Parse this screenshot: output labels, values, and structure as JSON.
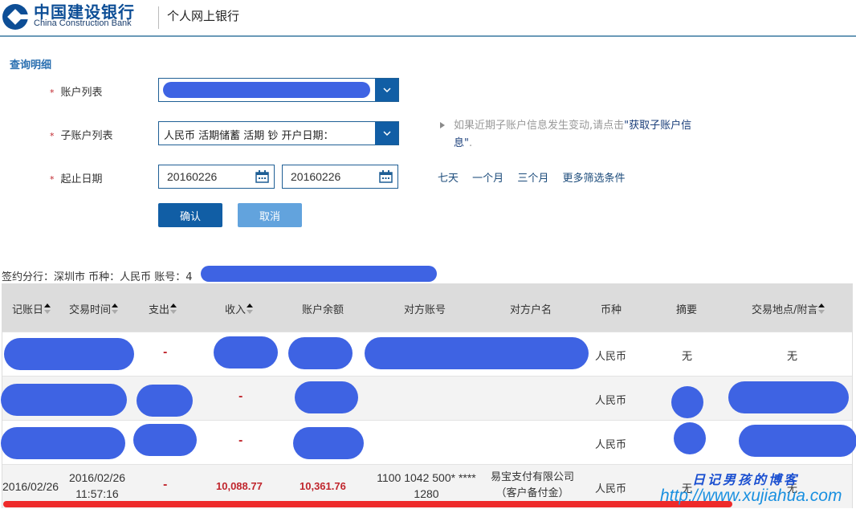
{
  "header": {
    "bank_name_cn": "中国建设银行",
    "bank_name_en": "China Construction Bank",
    "portal_title": "个人网上银行",
    "accent_color": "#115ea5"
  },
  "query": {
    "section_title": "查询明细",
    "account_list": {
      "label": "账户列表",
      "required_mark": "*",
      "value": "[redacted]"
    },
    "sub_account_list": {
      "label": "子账户列表",
      "required_mark": "*",
      "value": "人民币 活期储蓄 活期 钞 开户日期："
    },
    "date_range": {
      "label": "起止日期",
      "required_mark": "*",
      "start": "20160226",
      "end": "20160226"
    },
    "confirm_label": "确认",
    "cancel_label": "取消",
    "hint_prefix": "如果近期子账户信息发生变动,请点击",
    "hint_link": "\"获取子账户信息\"",
    "hint_suffix": ".",
    "quick_ranges": [
      "七天",
      "一个月",
      "三个月",
      "更多筛选条件"
    ]
  },
  "account_info": {
    "text": "签约分行：深圳市 币种：人民币 账号：4",
    "account_number": "[redacted]"
  },
  "table": {
    "columns": [
      {
        "label": "记账日",
        "sortable": true
      },
      {
        "label": "交易时间",
        "sortable": true
      },
      {
        "label": "支出",
        "sortable": true
      },
      {
        "label": "收入",
        "sortable": true
      },
      {
        "label": "账户余额",
        "sortable": false
      },
      {
        "label": "对方账号",
        "sortable": false
      },
      {
        "label": "对方户名",
        "sortable": false
      },
      {
        "label": "币种",
        "sortable": false
      },
      {
        "label": "摘要",
        "sortable": false
      },
      {
        "label": "交易地点/附言",
        "sortable": true
      }
    ],
    "rows": [
      {
        "date": "[redacted]",
        "time": "[redacted]",
        "expense": "-",
        "income": "[redacted]",
        "balance": "[redacted]",
        "counter_account": "[redacted]",
        "counter_name": "",
        "currency": "人民币",
        "summary": "无",
        "location": "无"
      },
      {
        "date": "[redacted]",
        "time": "[redacted]",
        "expense": "[redacted]",
        "income": "-",
        "balance": "[redacted]",
        "counter_account": "",
        "counter_name": "",
        "currency": "人民币",
        "summary": "[redacted]",
        "location": "[redacted]"
      },
      {
        "date": "[redacted]",
        "time": "[redacted]",
        "expense": "[redacted]",
        "income": "-",
        "balance": "[redacted]",
        "counter_account": "",
        "counter_name": "",
        "currency": "人民币",
        "summary": "[redacted]",
        "location": "[redacted]"
      },
      {
        "date": "2016/02/26",
        "time_date": "2016/02/26",
        "time_clock": "11:57:16",
        "expense": "-",
        "income": "10,088.77",
        "balance": "10,361.76",
        "counter_account_l1": "1100 1042 500* ****",
        "counter_account_l2": "1280",
        "counter_name_l1": "易宝支付有限公司",
        "counter_name_l2": "（客户备付金）",
        "currency": "人民币",
        "summary": "无",
        "location": "无"
      }
    ]
  },
  "watermark": {
    "title": "日记男孩的博客",
    "url": "http://www.xujiahua.com"
  }
}
